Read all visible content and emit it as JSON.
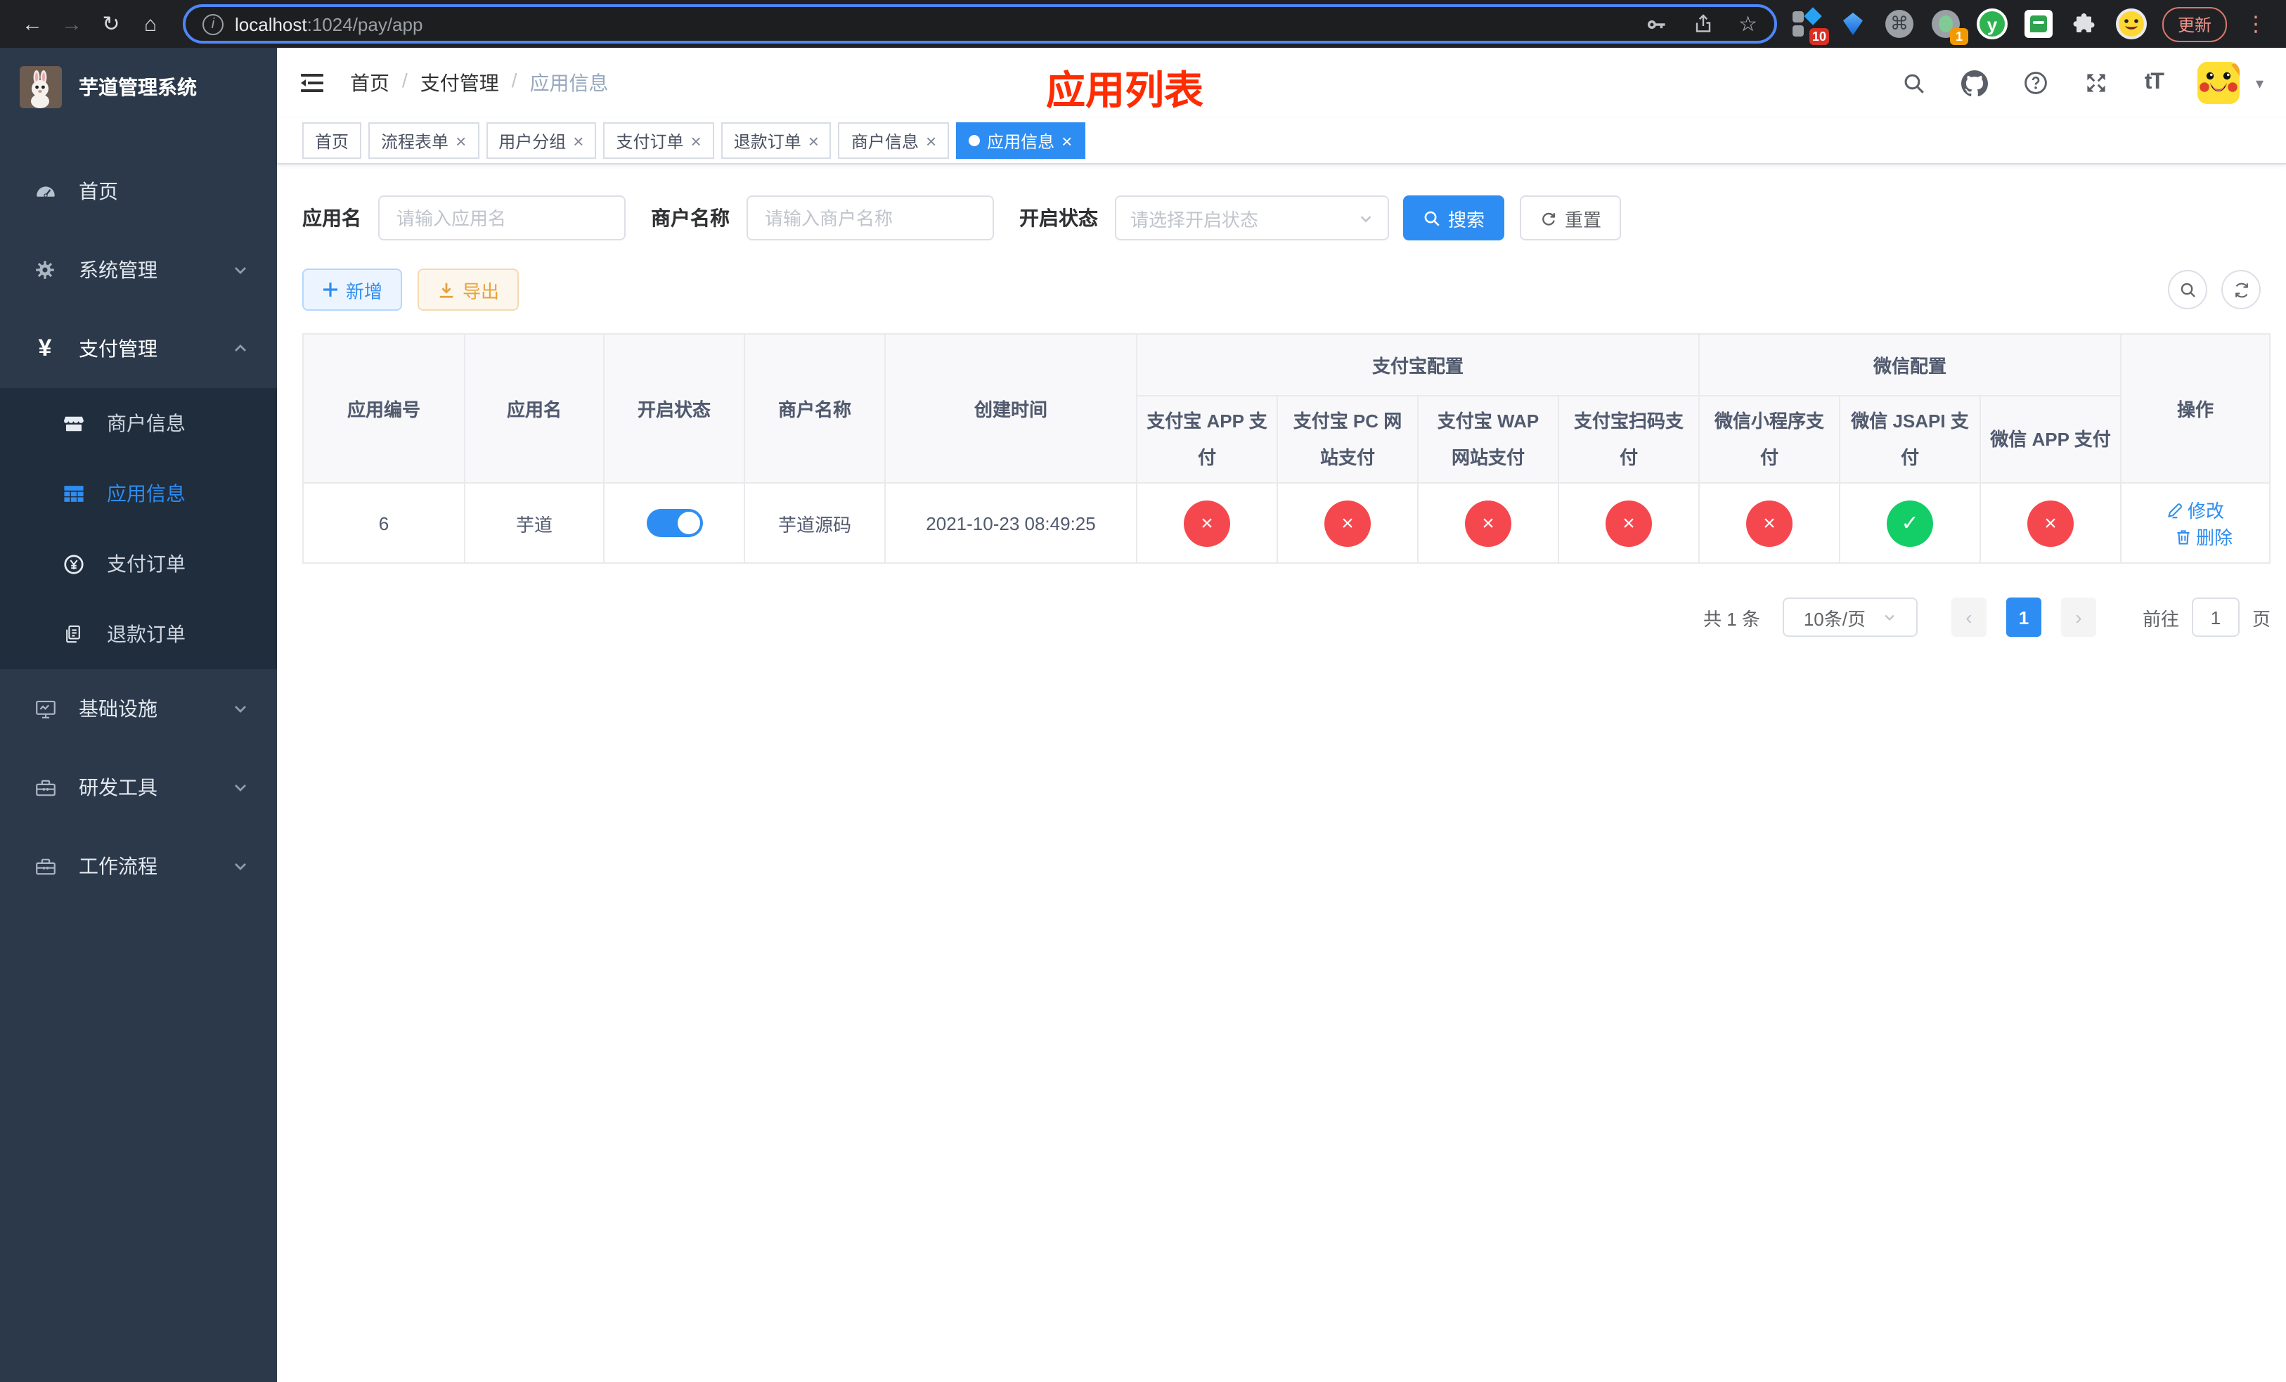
{
  "browser": {
    "url_host": "localhost",
    "url_rest": ":1024/pay/app",
    "update_label": "更新",
    "ext_badge_10": "10",
    "ext_badge_1": "1",
    "ext_y_letter": "y",
    "command_glyph": "⌘"
  },
  "icons": {
    "back": "←",
    "forward": "→",
    "reload": "↻",
    "home": "⌂",
    "star": "☆",
    "kebab": "⋮",
    "info_letter": "i",
    "close": "×",
    "check": "✓",
    "cross": "×",
    "yen": "¥",
    "caret": "▾",
    "font_size": "tT",
    "slash": "/",
    "prev": "‹",
    "next": "›"
  },
  "sidebar": {
    "title": "芋道管理系统",
    "items": [
      {
        "label": "首页"
      },
      {
        "label": "系统管理"
      },
      {
        "label": "支付管理"
      }
    ],
    "submenu": [
      {
        "label": "商户信息"
      },
      {
        "label": "应用信息",
        "active": true
      },
      {
        "label": "支付订单"
      },
      {
        "label": "退款订单"
      }
    ],
    "items_bottom": [
      {
        "label": "基础设施"
      },
      {
        "label": "研发工具"
      },
      {
        "label": "工作流程"
      }
    ]
  },
  "header": {
    "breadcrumb": [
      "首页",
      "支付管理",
      "应用信息"
    ],
    "page_title": "应用列表"
  },
  "tabs": [
    {
      "label": "首页",
      "closable": false,
      "active": false
    },
    {
      "label": "流程表单",
      "closable": true,
      "active": false
    },
    {
      "label": "用户分组",
      "closable": true,
      "active": false
    },
    {
      "label": "支付订单",
      "closable": true,
      "active": false
    },
    {
      "label": "退款订单",
      "closable": true,
      "active": false
    },
    {
      "label": "商户信息",
      "closable": true,
      "active": false
    },
    {
      "label": "应用信息",
      "closable": true,
      "active": true
    }
  ],
  "filter": {
    "app_name_label": "应用名",
    "app_name_placeholder": "请输入应用名",
    "merchant_label": "商户名称",
    "merchant_placeholder": "请输入商户名称",
    "status_label": "开启状态",
    "status_placeholder": "请选择开启状态",
    "search_label": "搜索",
    "reset_label": "重置"
  },
  "toolbar": {
    "add_label": "新增",
    "export_label": "导出"
  },
  "table": {
    "headers_left": [
      "应用编号",
      "应用名",
      "开启状态",
      "商户名称",
      "创建时间"
    ],
    "group_alipay": "支付宝配置",
    "group_wechat": "微信配置",
    "alipay_cols": [
      "支付宝 APP 支付",
      "支付宝 PC 网站支付",
      "支付宝 WAP 网站支付",
      "支付宝扫码支付"
    ],
    "wechat_cols": [
      "微信小程序支付",
      "微信 JSAPI 支付",
      "微信 APP 支付"
    ],
    "ops_header": "操作",
    "row": {
      "id": "6",
      "name": "芋道",
      "enabled": true,
      "merchant": "芋道源码",
      "created": "2021-10-23 08:49:25",
      "statuses": [
        "no",
        "no",
        "no",
        "no",
        "no",
        "yes",
        "no"
      ],
      "edit_label": "修改",
      "delete_label": "删除"
    }
  },
  "pagination": {
    "total": "共 1 条",
    "page_size": "10条/页",
    "current": "1",
    "goto_prefix": "前往",
    "goto_value": "1",
    "goto_suffix": "页"
  },
  "colors": {
    "accent": "#2e8df2",
    "danger": "#f5484e",
    "success": "#13ce66",
    "title_red": "#fe2c00",
    "sidebar_bg": "#2b394a",
    "submenu_bg": "#1f2d3d"
  }
}
